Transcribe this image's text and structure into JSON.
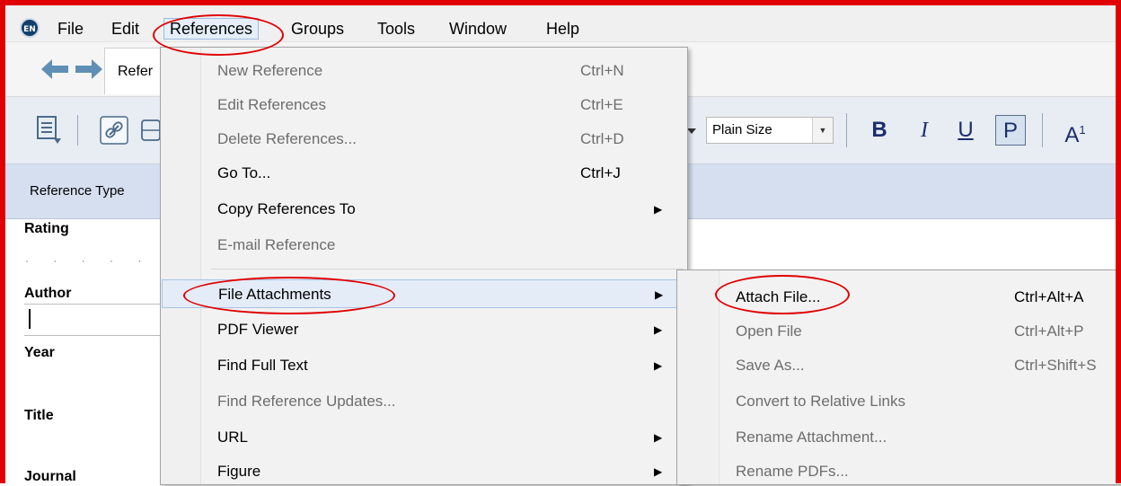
{
  "app_icon": "EN",
  "menubar": {
    "items": [
      "File",
      "Edit",
      "References",
      "Groups",
      "Tools",
      "Window",
      "Help"
    ]
  },
  "nav": {
    "tab_label": "Refer"
  },
  "toolbar": {
    "font_size": "Plain Size",
    "bold": "B",
    "italic": "I",
    "underline": "U",
    "plain": "P",
    "superscript": "A",
    "superscript_mark": "1"
  },
  "fields": {
    "reference_type_label": "Reference Type",
    "rating": "Rating",
    "rating_dots": "· · · · ·",
    "author": "Author",
    "year": "Year",
    "title": "Title",
    "journal": "Journal"
  },
  "references_menu": {
    "items": [
      {
        "label": "New Reference",
        "shortcut": "Ctrl+N",
        "enabled": false
      },
      {
        "label": "Edit References",
        "shortcut": "Ctrl+E",
        "enabled": false
      },
      {
        "label": "Delete References...",
        "shortcut": "Ctrl+D",
        "enabled": false
      },
      {
        "label": "Go To...",
        "shortcut": "Ctrl+J",
        "enabled": true
      },
      {
        "label": "Copy References To",
        "shortcut": "",
        "enabled": true,
        "submenu": true
      },
      {
        "label": "E-mail Reference",
        "shortcut": "",
        "enabled": false
      },
      {
        "label": "File Attachments",
        "shortcut": "",
        "enabled": true,
        "submenu": true
      },
      {
        "label": "PDF Viewer",
        "shortcut": "",
        "enabled": true,
        "submenu": true
      },
      {
        "label": "Find Full Text",
        "shortcut": "",
        "enabled": true,
        "submenu": true
      },
      {
        "label": "Find Reference Updates...",
        "shortcut": "",
        "enabled": false
      },
      {
        "label": "URL",
        "shortcut": "",
        "enabled": true,
        "submenu": true
      },
      {
        "label": "Figure",
        "shortcut": "",
        "enabled": true,
        "submenu": true
      }
    ]
  },
  "file_attachments_submenu": {
    "items": [
      {
        "label": "Attach File...",
        "shortcut": "Ctrl+Alt+A",
        "enabled": true
      },
      {
        "label": "Open File",
        "shortcut": "Ctrl+Alt+P",
        "enabled": false
      },
      {
        "label": "Save As...",
        "shortcut": "Ctrl+Shift+S",
        "enabled": false
      },
      {
        "label": "Convert to Relative Links",
        "shortcut": "",
        "enabled": false
      },
      {
        "label": "Rename Attachment...",
        "shortcut": "",
        "enabled": false
      },
      {
        "label": "Rename PDFs...",
        "shortcut": "",
        "enabled": false
      }
    ]
  },
  "colors": {
    "annotation_red": "#e00000",
    "highlight": "#e3ecf7"
  }
}
